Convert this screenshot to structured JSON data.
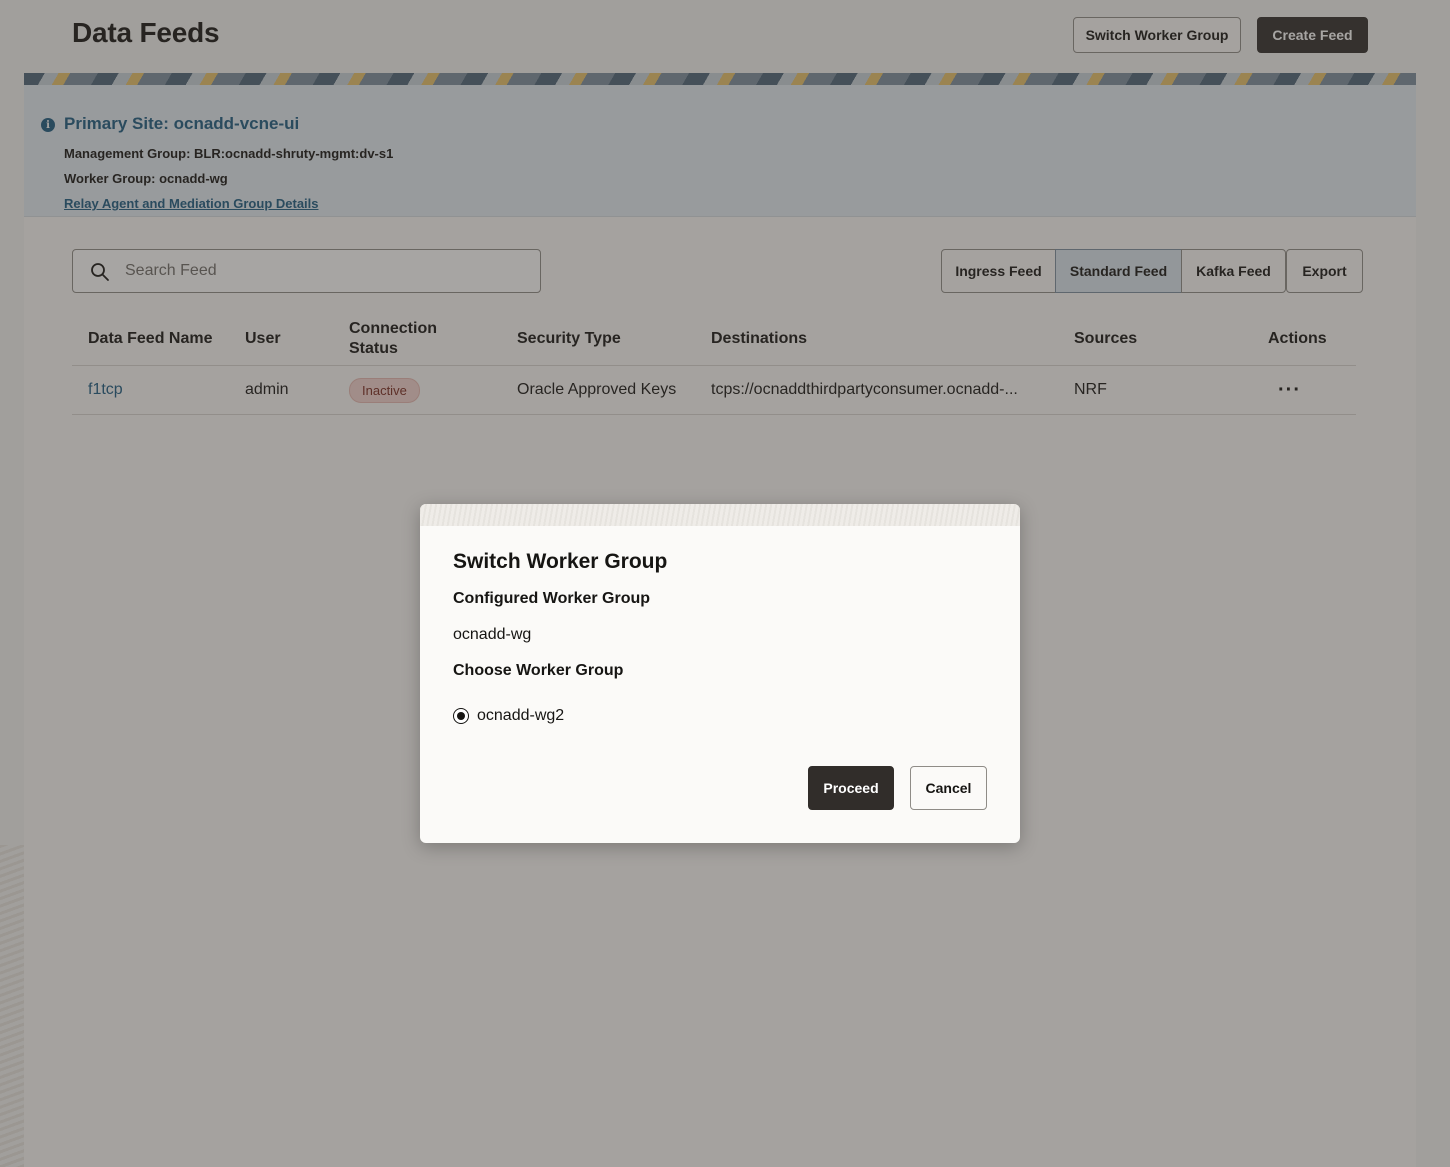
{
  "header": {
    "title": "Data Feeds",
    "switch_worker_group_label": "Switch Worker Group",
    "create_feed_label": "Create Feed"
  },
  "site": {
    "primary_site": "Primary Site: ocnadd-vcne-ui",
    "management_group": "Management Group: BLR:ocnadd-shruty-mgmt:dv-s1",
    "worker_group": "Worker Group: ocnadd-wg",
    "details_link": "Relay Agent and Mediation Group Details"
  },
  "search": {
    "placeholder": "Search Feed",
    "value": ""
  },
  "feed_types": {
    "ingress": "Ingress Feed",
    "standard": "Standard Feed",
    "kafka": "Kafka Feed",
    "export": "Export",
    "selected": "Standard Feed"
  },
  "table": {
    "headers": {
      "name": "Data Feed Name",
      "user": "User",
      "status_line1": "Connection",
      "status_line2": "Status",
      "security": "Security Type",
      "destinations": "Destinations",
      "sources": "Sources",
      "actions": "Actions"
    },
    "rows": [
      {
        "name": "f1tcp",
        "user": "admin",
        "status": "Inactive",
        "security": "Oracle Approved Keys",
        "destinations": "tcps://ocnaddthirdpartyconsumer.ocnadd-...",
        "sources": "NRF",
        "actions": "···"
      }
    ]
  },
  "dialog": {
    "title": "Switch Worker Group",
    "configured_label": "Configured Worker Group",
    "configured_value": "ocnadd-wg",
    "choose_label": "Choose Worker Group",
    "options": [
      "ocnadd-wg2"
    ],
    "selected_option": "ocnadd-wg2",
    "proceed_label": "Proceed",
    "cancel_label": "Cancel"
  },
  "colors": {
    "accent": "#1d5b82",
    "primary_button": "#312d2a",
    "site_box": "#e4edf4",
    "badge_inactive": "#f4d3cf"
  }
}
